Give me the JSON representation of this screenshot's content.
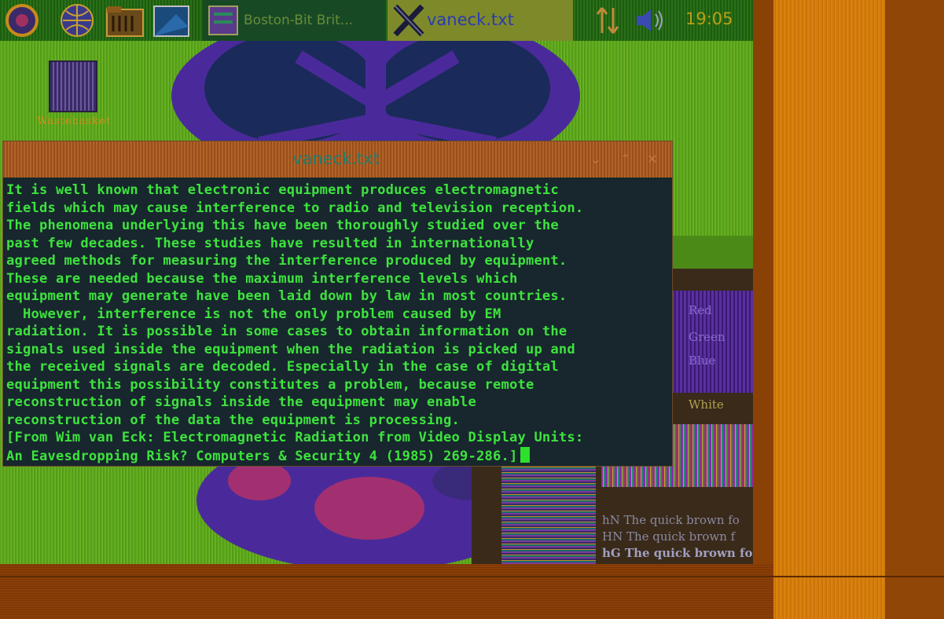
{
  "panel": {
    "launchers": [
      "debian-logo-icon",
      "browser-globe-icon",
      "file-manager-icon",
      "screenshot-icon"
    ],
    "tasks": [
      {
        "label": "Boston-Bit Brit...",
        "icon": "image-viewer-icon",
        "active": false
      },
      {
        "label": "vaneck.txt",
        "icon": "x-terminal-icon",
        "active": true
      }
    ],
    "tray": [
      "network-icon",
      "volume-icon"
    ],
    "clock": "19:05"
  },
  "desktop": {
    "trash_label": "Wastebasket"
  },
  "background_window": {
    "swatches": [
      "Red",
      "Green",
      "Blue",
      "White"
    ],
    "sample_lines": [
      "hN The quick brown fo",
      "HN The quick brown f",
      "hG The quick brown fo"
    ]
  },
  "window": {
    "title": "vaneck.txt",
    "controls": [
      "minimize",
      "maximize",
      "close"
    ],
    "lines": [
      "It is well known that electronic equipment produces electromagnetic",
      "fields which may cause interference to radio and television reception.",
      "The phenomena underlying this have been thoroughly studied over the",
      "past few decades. These studies have resulted in internationally",
      "agreed methods for measuring the interference produced by equipment.",
      "These are needed because the maximum interference levels which",
      "equipment may generate have been laid down by law in most countries.",
      "  However, interference is not the only problem caused by EM",
      "radiation. It is possible in some cases to obtain information on the",
      "signals used inside the equipment when the radiation is picked up and",
      "the received signals are decoded. Especially in the case of digital",
      "equipment this possibility constitutes a problem, because remote",
      "reconstruction of signals inside the equipment may enable",
      "reconstruction of the data the equipment is processing.",
      "[From Wim van Eck: Electromagnetic Radiation from Video Display Units:",
      "An Eavesdropping Risk? Computers & Security 4 (1985) 269-286.]"
    ]
  },
  "colors": {
    "terminal_bg": "#17272d",
    "terminal_text": "#3ee23e",
    "titlebar": "#b0642a",
    "panel": "#2a7018",
    "desktop": "#5aa61c",
    "wallpaper_purple": "#4a2a9a",
    "accent_orange": "#d27a0c"
  }
}
